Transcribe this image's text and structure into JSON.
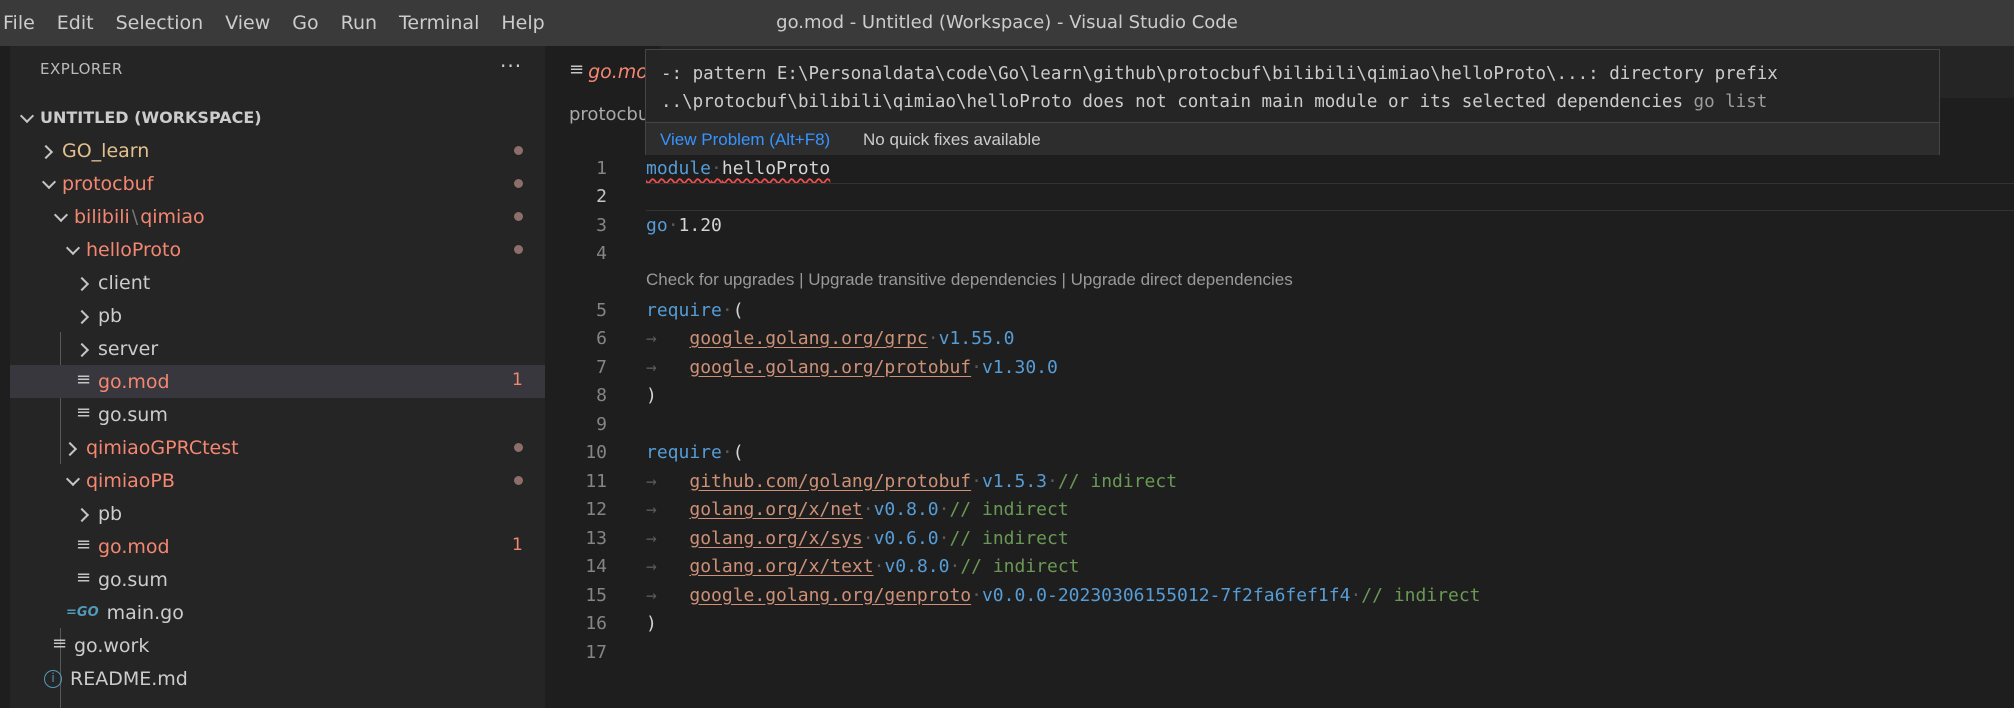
{
  "menu": [
    "File",
    "Edit",
    "Selection",
    "View",
    "Go",
    "Run",
    "Terminal",
    "Help"
  ],
  "window_title": "go.mod - Untitled (Workspace) - Visual Studio Code",
  "explorer": {
    "header": "EXPLORER",
    "more": "···",
    "workspace": "UNTITLED (WORKSPACE)",
    "items": {
      "go_learn": "GO_learn",
      "protocbuf": "protocbuf",
      "bilibili": "bilibili",
      "bilibili_sep": "\\",
      "qimiao": "qimiao",
      "helloproto": "helloProto",
      "client": "client",
      "pb1": "pb",
      "server": "server",
      "gomod1": "go.mod",
      "gomod1_badge": "1",
      "gosum1": "go.sum",
      "qimiaogprc": "qimiaoGPRCtest",
      "qimiaopb": "qimiaoPB",
      "pb2": "pb",
      "gomod2": "go.mod",
      "gomod2_badge": "1",
      "gosum2": "go.sum",
      "main_go": "main.go",
      "go_work": "go.work",
      "readme": "README.md"
    }
  },
  "tab": {
    "label": "go.mod"
  },
  "breadcrumb": "protocbuf",
  "hover": {
    "line1": "-: pattern E:\\Personaldata\\code\\Go\\learn\\github\\protocbuf\\bilibili\\qimiao\\helloProto\\...: directory prefix",
    "line2": "..\\protocbuf\\bilibili\\qimiao\\helloProto does not contain main module or its selected dependencies",
    "source": "go list",
    "view_problem": "View Problem (Alt+F8)",
    "no_fixes": "No quick fixes available"
  },
  "code": {
    "ln": [
      "1",
      "2",
      "3",
      "4",
      "5",
      "6",
      "7",
      "8",
      "9",
      "10",
      "11",
      "12",
      "13",
      "14",
      "15",
      "16",
      "17"
    ],
    "module_kw": "module",
    "module_name": "helloProto",
    "go_kw": "go",
    "go_ver": "1.20",
    "codelens": "Check for upgrades | Upgrade transitive dependencies | Upgrade direct dependencies",
    "require": "require",
    "open": "(",
    "close": ")",
    "req1": [
      {
        "pkg": "google.golang.org/grpc",
        "ver": "v1.55.0"
      },
      {
        "pkg": "google.golang.org/protobuf",
        "ver": "v1.30.0"
      }
    ],
    "req2": [
      {
        "pkg": "github.com/golang/protobuf",
        "ver": "v1.5.3",
        "cmt": "// indirect"
      },
      {
        "pkg": "golang.org/x/net",
        "ver": "v0.8.0",
        "cmt": "// indirect"
      },
      {
        "pkg": "golang.org/x/sys",
        "ver": "v0.6.0",
        "cmt": "// indirect"
      },
      {
        "pkg": "golang.org/x/text",
        "ver": "v0.8.0",
        "cmt": "// indirect"
      },
      {
        "pkg": "google.golang.org/genproto",
        "ver": "v0.0.0-20230306155012-7f2fa6fef1f4",
        "cmt": "// indirect"
      }
    ]
  },
  "colors": {
    "keyword": "#569cd6",
    "string": "#ce9178",
    "comment": "#6a9955",
    "error": "#f48771",
    "modified": "#e2c08d"
  }
}
